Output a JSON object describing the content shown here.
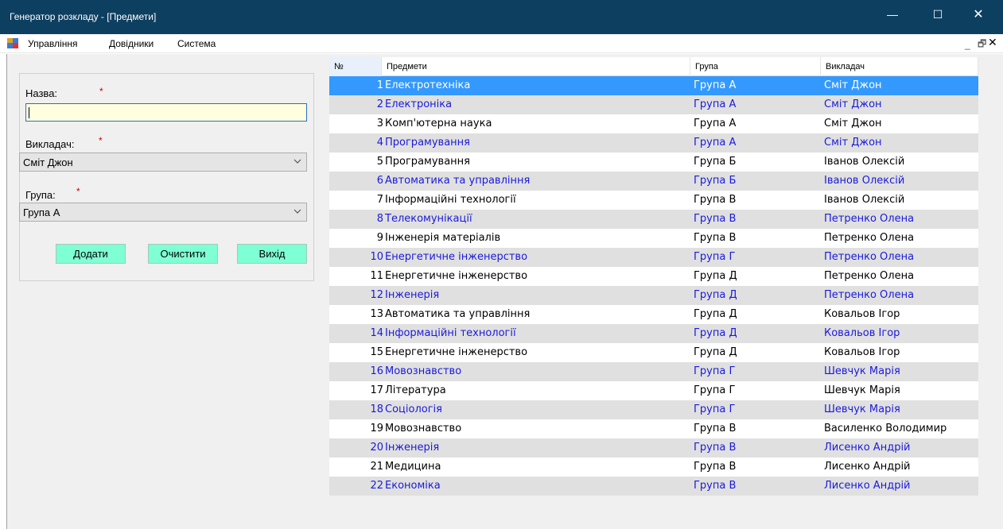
{
  "window": {
    "title": "Генератор розкладу - [Предмети]",
    "minimize_glyph": "—",
    "maximize_glyph": "☐",
    "close_glyph": "✕"
  },
  "menu": {
    "items": [
      "Управління",
      "Довідники",
      "Система"
    ],
    "mdi_minimize": "_",
    "mdi_restore": "🗗",
    "mdi_close": "✕"
  },
  "form": {
    "name_label": "Назва:",
    "name_value": "",
    "teacher_label": "Викладач:",
    "teacher_value": "Сміт Джон",
    "group_label": "Група:",
    "group_value": "Група А",
    "required_mark": "*",
    "add_button": "Додати",
    "clear_button": "Очистити",
    "exit_button": "Вихід"
  },
  "grid": {
    "headers": [
      "№",
      "Предмети",
      "Група",
      "Викладач"
    ],
    "selected_row": 1,
    "rows": [
      {
        "num": "1",
        "subject": "Електротехніка",
        "group": "Група А",
        "teacher": "Сміт Джон"
      },
      {
        "num": "2",
        "subject": "Електроніка",
        "group": "Група А",
        "teacher": "Сміт Джон"
      },
      {
        "num": "3",
        "subject": "Комп'ютерна наука",
        "group": "Група А",
        "teacher": "Сміт Джон"
      },
      {
        "num": "4",
        "subject": "Програмування",
        "group": "Група А",
        "teacher": "Сміт Джон"
      },
      {
        "num": "5",
        "subject": "Програмування",
        "group": "Група Б",
        "teacher": "Іванов Олексій"
      },
      {
        "num": "6",
        "subject": "Автоматика та управління",
        "group": "Група Б",
        "teacher": "Іванов Олексій"
      },
      {
        "num": "7",
        "subject": "Інформаційні технології",
        "group": "Група В",
        "teacher": "Іванов Олексій"
      },
      {
        "num": "8",
        "subject": "Телекомунікації",
        "group": "Група В",
        "teacher": "Петренко Олена"
      },
      {
        "num": "9",
        "subject": "Інженерія матеріалів",
        "group": "Група В",
        "teacher": "Петренко Олена"
      },
      {
        "num": "10",
        "subject": "Енергетичне інженерство",
        "group": "Група Г",
        "teacher": "Петренко Олена"
      },
      {
        "num": "11",
        "subject": "Енергетичне інженерство",
        "group": "Група Д",
        "teacher": "Петренко Олена"
      },
      {
        "num": "12",
        "subject": "Інженерія",
        "group": "Група Д",
        "teacher": "Петренко Олена"
      },
      {
        "num": "13",
        "subject": "Автоматика та управління",
        "group": "Група Д",
        "teacher": "Ковальов Ігор"
      },
      {
        "num": "14",
        "subject": "Інформаційні технології",
        "group": "Група Д",
        "teacher": "Ковальов Ігор"
      },
      {
        "num": "15",
        "subject": "Енергетичне інженерство",
        "group": "Група Д",
        "teacher": "Ковальов Ігор"
      },
      {
        "num": "16",
        "subject": "Мовознавство",
        "group": "Група Г",
        "teacher": "Шевчук Марія"
      },
      {
        "num": "17",
        "subject": "Література",
        "group": "Група Г",
        "teacher": "Шевчук Марія"
      },
      {
        "num": "18",
        "subject": "Соціологія",
        "group": "Група Г",
        "teacher": "Шевчук Марія"
      },
      {
        "num": "19",
        "subject": "Мовознавство",
        "group": "Група В",
        "teacher": "Василенко Володимир"
      },
      {
        "num": "20",
        "subject": "Інженерія",
        "group": "Група В",
        "teacher": "Лисенко Андрій"
      },
      {
        "num": "21",
        "subject": "Медицина",
        "group": "Група В",
        "teacher": "Лисенко Андрій"
      },
      {
        "num": "22",
        "subject": "Економіка",
        "group": "Група В",
        "teacher": "Лисенко Андрій"
      }
    ]
  },
  "colors": {
    "titlebar": "#0d3f60",
    "selection": "#3399ff",
    "alt_row_text": "#1a1adc",
    "button_bg": "#7fffd4",
    "input_bg": "#ffffe0"
  }
}
